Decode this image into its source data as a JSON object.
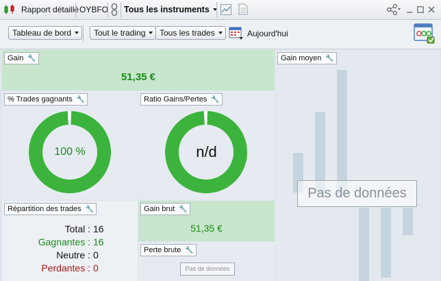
{
  "topbar": {
    "report_label": "Rapport détaillé",
    "account_label": "OYBFO",
    "instruments_label": "Tous les instruments"
  },
  "toolbar": {
    "dashboard_label": "Tableau de bord",
    "trading_label": "Tout le trading",
    "trades_label": "Tous les trades",
    "date_label": "Aujourd'hui"
  },
  "panels": {
    "gain": {
      "title": "Gain",
      "value": "51,35 €"
    },
    "win_pct": {
      "title": "% Trades gagnants",
      "value": "100 %",
      "fraction": 1.0
    },
    "ratio": {
      "title": "Ratio Gains/Pertes",
      "value": "n/d",
      "fraction": 1.0
    },
    "avg_gain": {
      "title": "Gain moyen",
      "no_data": "Pas de données"
    },
    "distribution": {
      "title": "Répartition des trades",
      "rows": [
        {
          "label": "Total :",
          "value": "16"
        },
        {
          "label": "Gagnantes :",
          "value": "16"
        },
        {
          "label": "Neutre :",
          "value": "0"
        },
        {
          "label": "Perdantes :",
          "value": "0"
        }
      ]
    },
    "gross_gain": {
      "title": "Gain brut",
      "value": "51,35 €"
    },
    "gross_loss": {
      "title": "Perte brute",
      "no_data": "Pas de données"
    }
  },
  "colors": {
    "positive": "#1a8a1a",
    "negative": "#a11a1a",
    "donut": "#3cb33c",
    "gain_bg": "#c8e6cd"
  }
}
